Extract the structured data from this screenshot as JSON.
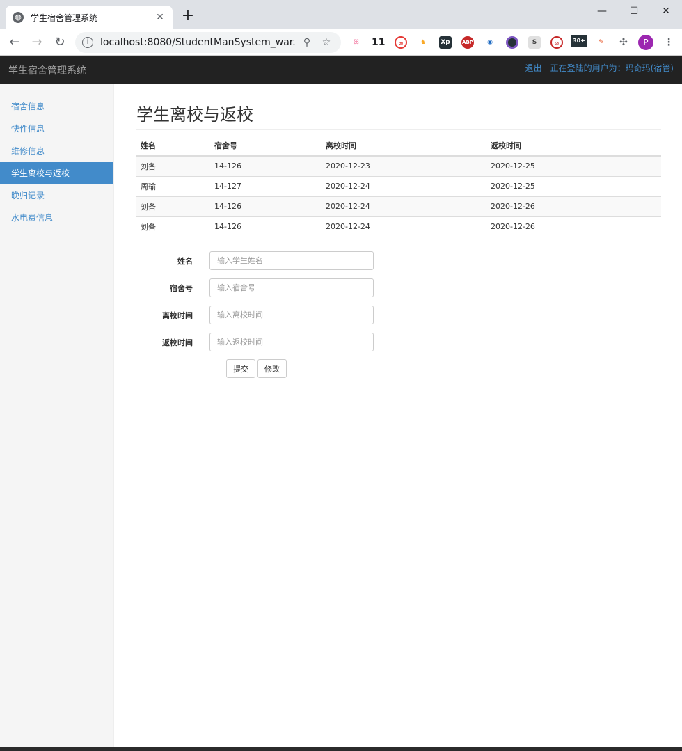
{
  "browser": {
    "tab_title": "学生宿舍管理系统",
    "new_tab": "+",
    "url": "localhost:8080/StudentManSystem_war...",
    "extensions": [
      "11",
      "Xp",
      "ABP",
      "S",
      "30+",
      "P"
    ]
  },
  "navbar": {
    "brand": "学生宿舍管理系统",
    "logout": "退出",
    "user_status": "正在登陆的用户为：玛奇玛(宿管)"
  },
  "sidebar": {
    "items": [
      {
        "label": "宿舍信息"
      },
      {
        "label": "快件信息"
      },
      {
        "label": "维修信息"
      },
      {
        "label": "学生离校与返校"
      },
      {
        "label": "晚归记录"
      },
      {
        "label": "水电费信息"
      }
    ],
    "active_index": 3
  },
  "main": {
    "title": "学生离校与返校",
    "table": {
      "headers": [
        "姓名",
        "宿舍号",
        "离校时间",
        "返校时间"
      ],
      "rows": [
        [
          "刘备",
          "14-126",
          "2020-12-23",
          "2020-12-25"
        ],
        [
          "周瑜",
          "14-127",
          "2020-12-24",
          "2020-12-25"
        ],
        [
          "刘备",
          "14-126",
          "2020-12-24",
          "2020-12-26"
        ],
        [
          "刘备",
          "14-126",
          "2020-12-24",
          "2020-12-26"
        ]
      ]
    },
    "form": {
      "name_label": "姓名",
      "name_placeholder": "输入学生姓名",
      "room_label": "宿舍号",
      "room_placeholder": "输入宿舍号",
      "leave_label": "离校时间",
      "leave_placeholder": "输入离校时间",
      "return_label": "返校时间",
      "return_placeholder": "输入返校时间",
      "submit_label": "提交",
      "modify_label": "修改"
    }
  },
  "colors": {
    "navbar_bg": "#222222",
    "accent": "#428bca",
    "sidebar_bg": "#f5f5f5"
  }
}
